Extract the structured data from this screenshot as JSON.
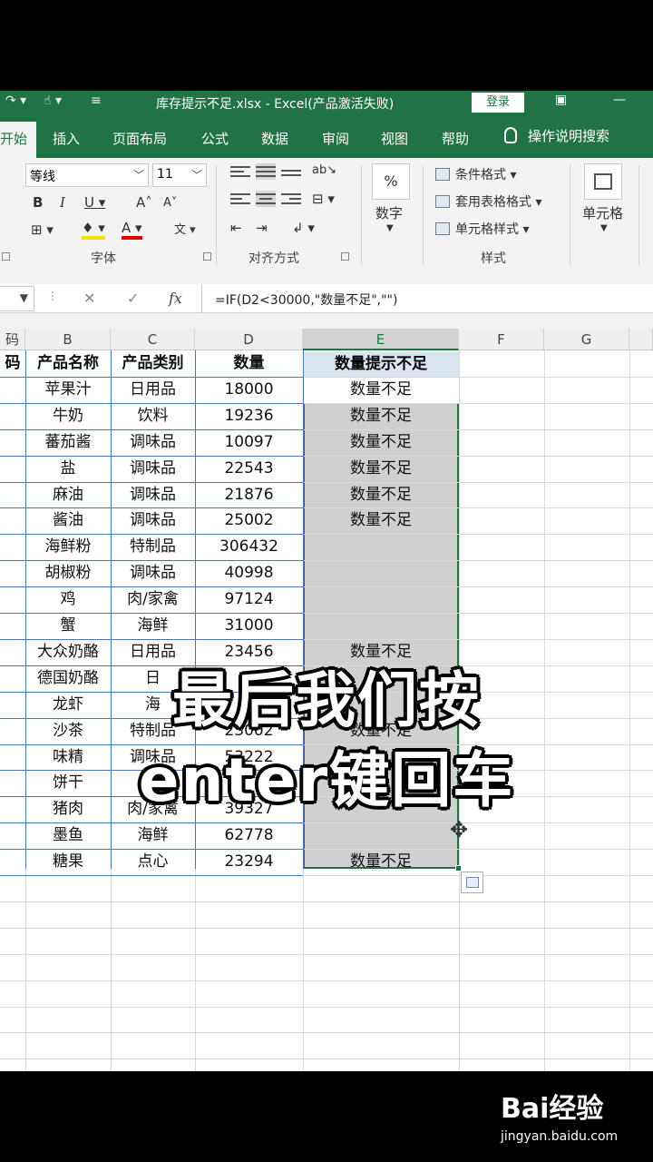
{
  "titlebar": {
    "title": "库存提示不足.xlsx  -  Excel(产品激活失败)",
    "login": "登录"
  },
  "tabs": [
    "开始",
    "插入",
    "页面布局",
    "公式",
    "数据",
    "审阅",
    "视图",
    "帮助"
  ],
  "tell_me": "操作说明搜索",
  "ribbon": {
    "font_name": "等线",
    "font_size": "11",
    "group_font": "字体",
    "group_align": "对齐方式",
    "number_label": "数字",
    "percent": "%",
    "conditional": "条件格式",
    "table_format": "套用表格格式",
    "cell_style": "单元格样式",
    "group_style": "样式",
    "cells_label": "单元格"
  },
  "formula": "=IF(D2<30000,\"数量不足\",\"\")",
  "columns": [
    "码",
    "B",
    "C",
    "D",
    "E",
    "F",
    "G"
  ],
  "headers": [
    "码",
    "产品名称",
    "产品类别",
    "数量",
    "数量提示不足"
  ],
  "rows": [
    {
      "name": "苹果汁",
      "cat": "日用品",
      "qty": "18000",
      "flag": "数量不足"
    },
    {
      "name": "牛奶",
      "cat": "饮料",
      "qty": "19236",
      "flag": "数量不足"
    },
    {
      "name": "蕃茄酱",
      "cat": "调味品",
      "qty": "10097",
      "flag": "数量不足"
    },
    {
      "name": "盐",
      "cat": "调味品",
      "qty": "22543",
      "flag": "数量不足"
    },
    {
      "name": "麻油",
      "cat": "调味品",
      "qty": "21876",
      "flag": "数量不足"
    },
    {
      "name": "酱油",
      "cat": "调味品",
      "qty": "25002",
      "flag": "数量不足"
    },
    {
      "name": "海鲜粉",
      "cat": "特制品",
      "qty": "306432",
      "flag": ""
    },
    {
      "name": "胡椒粉",
      "cat": "调味品",
      "qty": "40998",
      "flag": ""
    },
    {
      "name": "鸡",
      "cat": "肉/家禽",
      "qty": "97124",
      "flag": ""
    },
    {
      "name": "蟹",
      "cat": "海鲜",
      "qty": "31000",
      "flag": ""
    },
    {
      "name": "大众奶酪",
      "cat": "日用品",
      "qty": "23456",
      "flag": "数量不足"
    },
    {
      "name": "德国奶酪",
      "cat": "日",
      "qty": "",
      "flag": ""
    },
    {
      "name": "龙虾",
      "cat": "海",
      "qty": "",
      "flag": ""
    },
    {
      "name": "沙茶",
      "cat": "特制品",
      "qty": "23002",
      "flag": "数量不足"
    },
    {
      "name": "味精",
      "cat": "调味品",
      "qty": "53222",
      "flag": ""
    },
    {
      "name": "饼干",
      "cat": "",
      "qty": "",
      "flag": ""
    },
    {
      "name": "猪肉",
      "cat": "肉/家禽",
      "qty": "39327",
      "flag": ""
    },
    {
      "name": "墨鱼",
      "cat": "海鲜",
      "qty": "62778",
      "flag": ""
    },
    {
      "name": "糖果",
      "cat": "点心",
      "qty": "23294",
      "flag": "数量不足"
    }
  ],
  "subtitle": {
    "line1": "最后我们按",
    "line2": "enter键回车"
  },
  "watermark": {
    "logo": "Bai经验",
    "url": "jingyan.baidu.com"
  }
}
